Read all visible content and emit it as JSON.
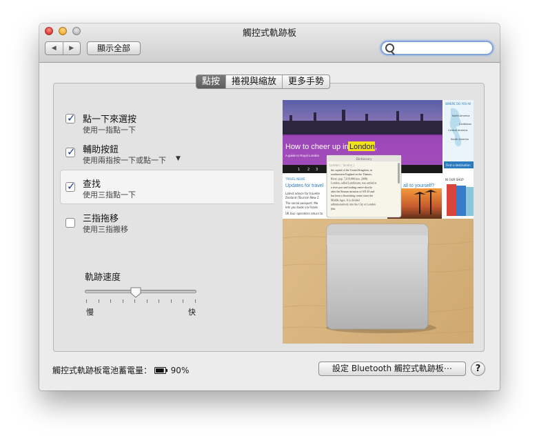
{
  "window": {
    "title": "觸控式軌跡板"
  },
  "toolbar": {
    "back_label": "◀",
    "forward_label": "▶",
    "show_all_label": "顯示全部",
    "search_placeholder": ""
  },
  "tabs": [
    {
      "label": "點按",
      "active": true
    },
    {
      "label": "捲視與縮放",
      "active": false
    },
    {
      "label": "更多手勢",
      "active": false
    }
  ],
  "options": [
    {
      "label": "點一下來選按",
      "sub": "使用一指點一下",
      "checked": true
    },
    {
      "label": "輔助按鈕",
      "sub": "使用兩指按一下或點一下",
      "checked": true,
      "has_dropdown": true
    },
    {
      "label": "查找",
      "sub": "使用三指點一下",
      "checked": true,
      "selected": true
    },
    {
      "label": "三指拖移",
      "sub": "使用三指搬移",
      "checked": false
    }
  ],
  "tracking": {
    "label": "軌跡速度",
    "slow": "慢",
    "fast": "快",
    "level": 0.45,
    "ticks": 10
  },
  "preview": {
    "headline_pre": "How to cheer up in ",
    "headline_highlight": "London",
    "headline_post": ",",
    "guide_label": "A guide to Royal London",
    "pager": [
      "1",
      "2",
      "3"
    ],
    "news_kicker": "TRAVEL NEWS",
    "news_title": "Updates for travel",
    "news_items": [
      "Latest advice for travelle",
      "Zealand (Tourism New Z",
      "The social passport: Mo",
      "lets you book via Faceb",
      "UK tour operators return to"
    ],
    "treat_title": "all to yourself?",
    "shop_label": "IN OUR SHOP",
    "map_title": "WHERE DO YOU W",
    "map_regions": [
      "North America",
      "Caribbean",
      "Central America",
      "South America"
    ],
    "find_destination": "Find a destination",
    "popup_title": "Dictionary",
    "popup_entry": "London | 'landən |",
    "popup_lines": [
      "the capital of the United Kingdom, in",
      "southeastern England on the Thames;",
      "River; pop. 7,619,800 (est. 2008).",
      "London, called Londinium, was settled at",
      "a river port and trading centre shortly",
      "after the Roman invasion of AD 43 and",
      "has been a flourishing centre since the",
      "Middle Ages. It is divided",
      "administratively into the City of London",
      "(the"
    ]
  },
  "footer": {
    "battery_label": "觸控式軌跡板電池蓄電量：",
    "battery_value": "90%",
    "battery_level": 0.9,
    "bt_button": "設定 Bluetooth 觸控式軌跡板⋯",
    "help": "?"
  },
  "colors": {
    "accent": "#183c8f",
    "search_ring": "#7fa5dc",
    "highlight": "#f2e21c",
    "purple_band": "#9b3fb8"
  }
}
